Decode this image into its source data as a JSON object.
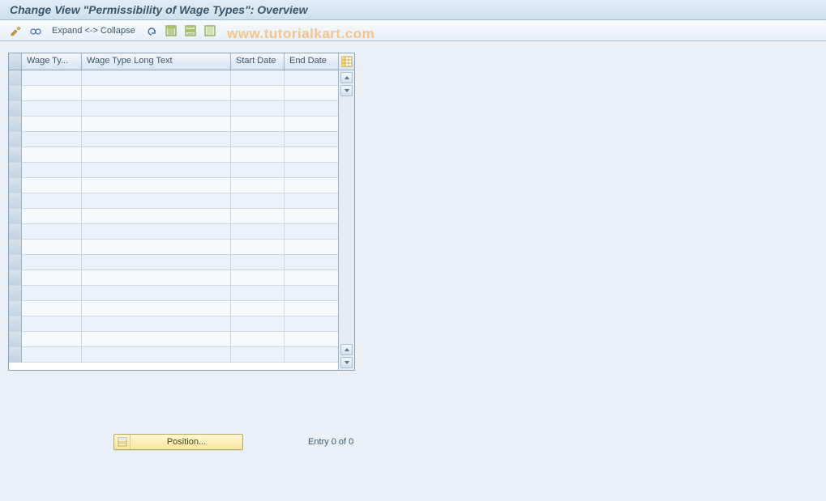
{
  "title": "Change View \"Permissibility of Wage Types\": Overview",
  "toolbar": {
    "expand_collapse": "Expand <-> Collapse"
  },
  "watermark": "www.tutorialkart.com",
  "grid": {
    "columns": {
      "wage_type": "Wage Ty...",
      "long_text": "Wage Type Long Text",
      "start_date": "Start Date",
      "end_date": "End Date"
    },
    "rows": 19
  },
  "footer": {
    "position_label": "Position...",
    "entry_text": "Entry 0 of 0"
  },
  "icons": {
    "pencil_glasses": "edit-detail-icon",
    "glasses": "glasses-icon",
    "undo": "undo-icon",
    "save1": "select-all-icon",
    "save2": "select-block-icon",
    "save3": "deselect-all-icon",
    "config": "table-settings-icon"
  }
}
